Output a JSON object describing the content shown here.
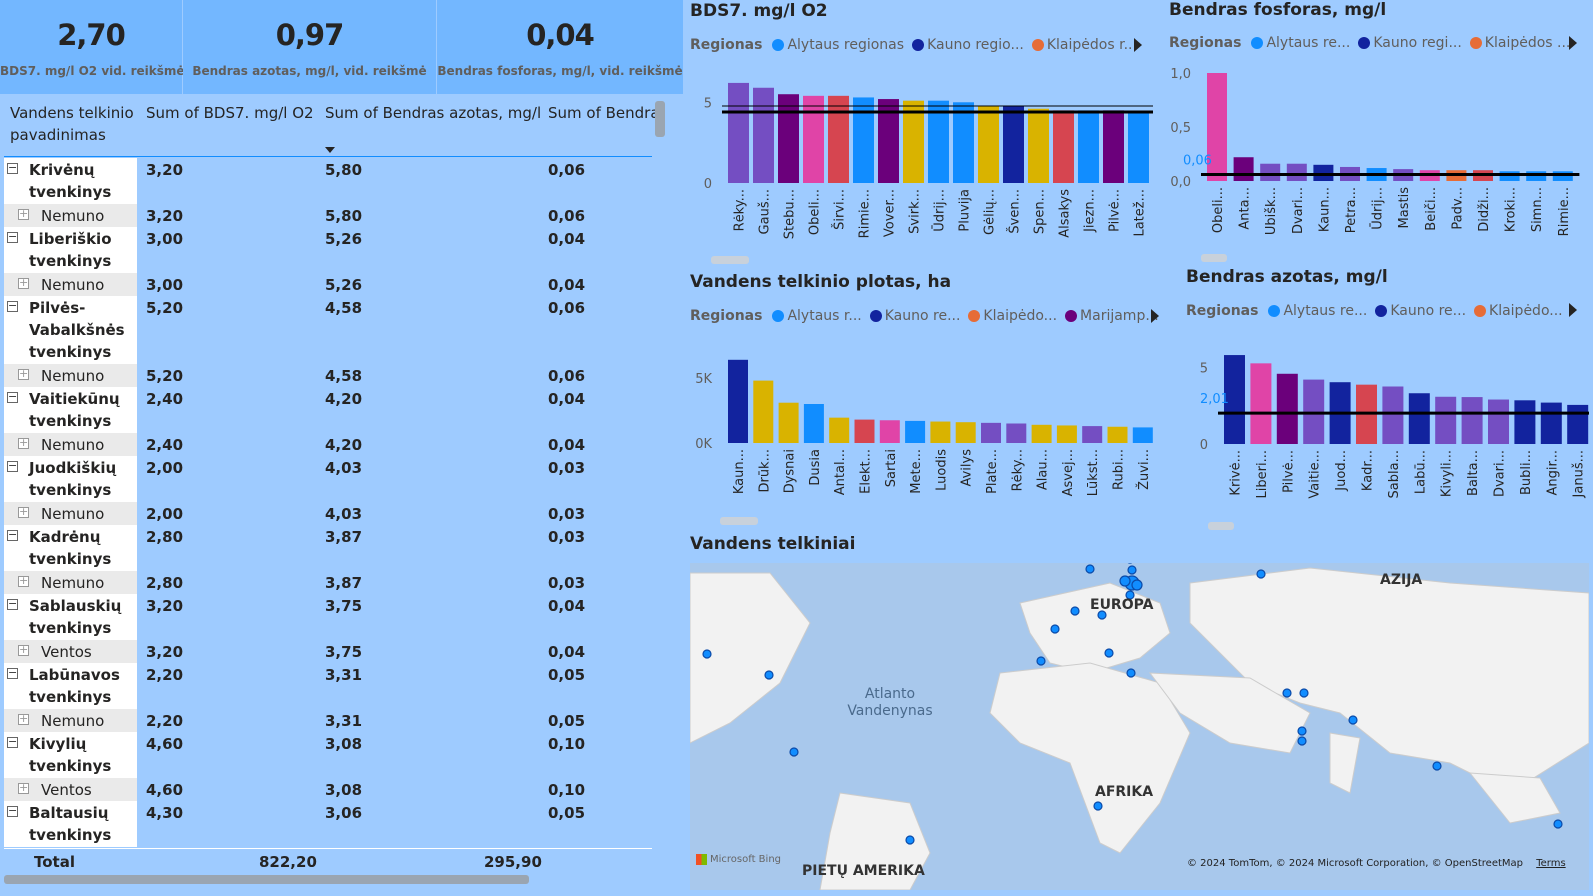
{
  "cards": [
    {
      "value": "2,70",
      "label": "BDS7. mg/l O2 vid. reikšmė"
    },
    {
      "value": "0,97",
      "label": "Bendras azotas, mg/l, vid. reikšmė"
    },
    {
      "value": "0,04",
      "label": "Bendras fosforas, mg/l, vid. reikšmė"
    }
  ],
  "matrix": {
    "headers": [
      "Vandens telkinio pavadinimas",
      "Sum of BDS7. mg/l O2",
      "Sum of Bendras azotas, mg/l",
      "Sum of Bendra"
    ],
    "rows": [
      {
        "name": "Krivėnų tvenkinys",
        "bds": "3,20",
        "n": "5,80",
        "p": "0,06",
        "sub": "Nemuno"
      },
      {
        "name": "Liberiškio tvenkinys",
        "bds": "3,00",
        "n": "5,26",
        "p": "0,04",
        "sub": "Nemuno"
      },
      {
        "name": "Pilvės-Vabalkšnės tvenkinys",
        "bds": "5,20",
        "n": "4,58",
        "p": "0,06",
        "sub": "Nemuno"
      },
      {
        "name": "Vaitiekūnų tvenkinys",
        "bds": "2,40",
        "n": "4,20",
        "p": "0,04",
        "sub": "Nemuno"
      },
      {
        "name": "Juodkiškių tvenkinys",
        "bds": "2,00",
        "n": "4,03",
        "p": "0,03",
        "sub": "Nemuno"
      },
      {
        "name": "Kadrėnų tvenkinys",
        "bds": "2,80",
        "n": "3,87",
        "p": "0,03",
        "sub": "Nemuno"
      },
      {
        "name": "Sablauskių tvenkinys",
        "bds": "3,20",
        "n": "3,75",
        "p": "0,04",
        "sub": "Ventos"
      },
      {
        "name": "Labūnavos tvenkinys",
        "bds": "2,20",
        "n": "3,31",
        "p": "0,05",
        "sub": "Nemuno"
      },
      {
        "name": "Kivylių tvenkinys",
        "bds": "4,60",
        "n": "3,08",
        "p": "0,10",
        "sub": "Ventos"
      },
      {
        "name": "Baltausių tvenkinys",
        "bds": "4,30",
        "n": "3,06",
        "p": "0,05",
        "sub": ""
      }
    ],
    "total": {
      "label": "Total",
      "bds": "822,20",
      "n": "295,90"
    }
  },
  "charts_text": {
    "bds_title": "BDS7. mg/l O2",
    "p_title": "Bendras fosforas, mg/l",
    "area_title": "Vandens telkinio plotas, ha",
    "n_title": "Bendras azotas, mg/l",
    "map_title": "Vandens telkiniai",
    "legend_label": "Regionas",
    "bds_legend": [
      "Alytaus regionas",
      "Kauno regio...",
      "Klaipėdos r..."
    ],
    "p_legend": [
      "Alytaus re...",
      "Kauno regi...",
      "Klaipėdos ..."
    ],
    "area_legend": [
      "Alytaus r...",
      "Kauno re...",
      "Klaipėdo...",
      "Marijamp..."
    ],
    "n_legend": [
      "Alytaus re...",
      "Kauno re...",
      "Klaipėdo..."
    ]
  },
  "colors": {
    "alytus": "#118dff",
    "kaunas": "#12239e",
    "klaipeda": "#e66c37",
    "marijampole": "#6b007b",
    "pink": "#e044a7",
    "purple": "#744ec2",
    "gold": "#d9b300",
    "red": "#d64550"
  },
  "chart_data": [
    {
      "type": "bar",
      "title": "BDS7. mg/l O2",
      "categories": [
        "Rėky...",
        "Gauš...",
        "Stebu...",
        "Obeli...",
        "Širvi...",
        "Rimie...",
        "Vover...",
        "Svirk...",
        "Ūdrij...",
        "Pluvija",
        "Gėlių...",
        "Šven...",
        "Spen...",
        "Alsakys",
        "Jiezn...",
        "Pilvė...",
        "Latež..."
      ],
      "values": [
        6.2,
        5.9,
        5.5,
        5.4,
        5.4,
        5.3,
        5.2,
        5.1,
        5.1,
        5.0,
        4.8,
        4.8,
        4.6,
        4.5,
        4.5,
        4.5,
        4.4
      ],
      "colors": [
        "#744ec2",
        "#744ec2",
        "#6b007b",
        "#e044a7",
        "#d64550",
        "#118dff",
        "#6b007b",
        "#d9b300",
        "#118dff",
        "#118dff",
        "#d9b300",
        "#12239e",
        "#d9b300",
        "#d64550",
        "#118dff",
        "#6b007b",
        "#118dff"
      ],
      "ylim": [
        0,
        7
      ],
      "ticks": [
        "0",
        "5"
      ],
      "average": 4.4
    },
    {
      "type": "bar",
      "title": "Bendras fosforas, mg/l",
      "categories": [
        "Obeli...",
        "Anta...",
        "Ubišk...",
        "Dvari...",
        "Kaun...",
        "Petra...",
        "Ūdrij...",
        "Mastis",
        "Beiči...",
        "Padv...",
        "Didži...",
        "Kroki...",
        "Simn...",
        "Rimie..."
      ],
      "values": [
        1.0,
        0.22,
        0.16,
        0.16,
        0.15,
        0.13,
        0.12,
        0.11,
        0.1,
        0.1,
        0.1,
        0.09,
        0.09,
        0.09
      ],
      "colors": [
        "#e044a7",
        "#6b007b",
        "#744ec2",
        "#744ec2",
        "#12239e",
        "#744ec2",
        "#118dff",
        "#744ec2",
        "#e044a7",
        "#e66c37",
        "#d64550",
        "#118dff",
        "#118dff",
        "#118dff"
      ],
      "ylim": [
        0,
        1.0
      ],
      "ticks": [
        "0,0",
        "0,5",
        "1,0"
      ],
      "average": 0.06,
      "average_label": "0,06"
    },
    {
      "type": "bar",
      "title": "Vandens telkinio plotas, ha",
      "categories": [
        "Kaun...",
        "Drūk...",
        "Dysnai",
        "Dusia",
        "Antal...",
        "Elekt...",
        "Sartai",
        "Mete...",
        "Luodis",
        "Avilys",
        "Plate...",
        "Rėky...",
        "Alau...",
        "Asvej...",
        "Lūkst...",
        "Rubi...",
        "Žuvi..."
      ],
      "values": [
        6400,
        4800,
        3100,
        3000,
        1950,
        1800,
        1750,
        1700,
        1650,
        1600,
        1550,
        1500,
        1400,
        1350,
        1300,
        1250,
        1200
      ],
      "colors": [
        "#12239e",
        "#d9b300",
        "#d9b300",
        "#118dff",
        "#d9b300",
        "#d64550",
        "#e044a7",
        "#118dff",
        "#d9b300",
        "#d9b300",
        "#744ec2",
        "#744ec2",
        "#d9b300",
        "#d9b300",
        "#744ec2",
        "#d9b300",
        "#118dff"
      ],
      "ylim": [
        0,
        7000
      ],
      "ticks": [
        "0K",
        "5K"
      ]
    },
    {
      "type": "bar",
      "title": "Bendras azotas, mg/l",
      "categories": [
        "Krivė...",
        "Liberi...",
        "Pilvė...",
        "Vaitie...",
        "Juod...",
        "Kadr...",
        "Sabla...",
        "Labū...",
        "Kivyli...",
        "Balta...",
        "Dvari...",
        "Bubli...",
        "Angir...",
        "Januš..."
      ],
      "values": [
        5.8,
        5.26,
        4.58,
        4.2,
        4.03,
        3.87,
        3.75,
        3.31,
        3.08,
        3.06,
        2.9,
        2.85,
        2.7,
        2.55
      ],
      "colors": [
        "#12239e",
        "#e044a7",
        "#6b007b",
        "#744ec2",
        "#12239e",
        "#d64550",
        "#744ec2",
        "#12239e",
        "#744ec2",
        "#744ec2",
        "#744ec2",
        "#12239e",
        "#12239e",
        "#12239e"
      ],
      "ylim": [
        0,
        6
      ],
      "ticks": [
        "0",
        "5"
      ],
      "average": 2.01,
      "average_label": "2,01"
    }
  ],
  "map": {
    "labels": [
      "EUROPA",
      "AZIJA",
      "Atlanto Vandenynas",
      "AFRIKA",
      "PIETŲ AMERIKA"
    ],
    "attribution": "© 2024 TomTom, © 2024 Microsoft Corporation, © OpenStreetMap",
    "terms": "Terms",
    "logo": "Microsoft Bing"
  }
}
